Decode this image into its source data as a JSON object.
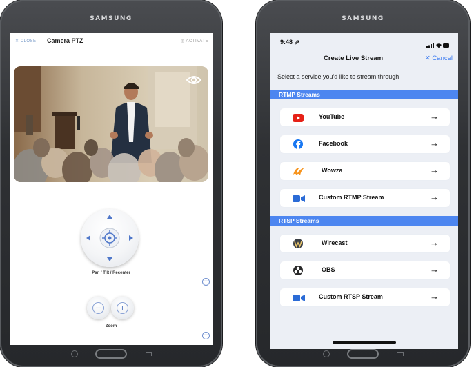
{
  "left_device": {
    "brand": "SAMSUNG",
    "header": {
      "close_label": "✕ CLOSE",
      "title": "Camera PTZ",
      "activate_label": "◎ ACTIVATE"
    },
    "ptz_label": "Pan / Tilt / Recenter",
    "zoom": {
      "minus": "−",
      "plus": "+",
      "label": "Zoom"
    },
    "add_symbol": "+"
  },
  "right_device": {
    "brand": "SAMSUNG",
    "status": {
      "time": "9:48 ⇗"
    },
    "header": {
      "title": "Create Live Stream",
      "cancel_label": "✕ Cancel"
    },
    "subtitle": "Select a service you'd like to stream through",
    "sections": [
      {
        "title": "RTMP Streams",
        "items": [
          {
            "label": "YouTube",
            "icon": "youtube-icon",
            "color": "#e62117"
          },
          {
            "label": "Facebook",
            "icon": "facebook-icon",
            "color": "#1877f2"
          },
          {
            "label": "Wowza",
            "icon": "wowza-icon",
            "color": "#f7941d"
          },
          {
            "label": "Custom RTMP Stream",
            "icon": "camera-icon",
            "color": "#2b6bd6"
          }
        ]
      },
      {
        "title": "RTSP Streams",
        "items": [
          {
            "label": "Wirecast",
            "icon": "wirecast-icon",
            "color": "#3b3f45"
          },
          {
            "label": "OBS",
            "icon": "obs-icon",
            "color": "#2a2a2a"
          },
          {
            "label": "Custom RTSP Stream",
            "icon": "camera-icon",
            "color": "#2b6bd6"
          }
        ]
      }
    ],
    "arrow": "→"
  },
  "colors": {
    "accent": "#4d86f0",
    "link": "#3c7bf0"
  }
}
